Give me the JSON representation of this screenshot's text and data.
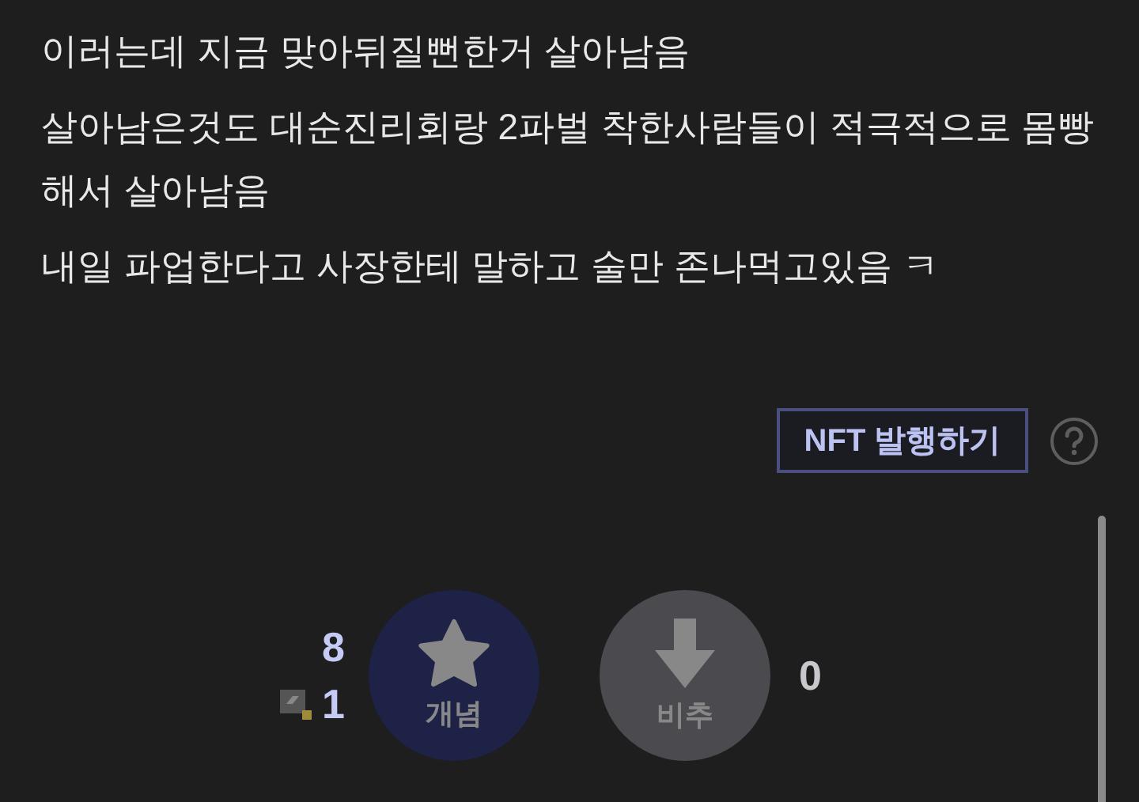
{
  "post": {
    "paragraphs": [
      "이러는데 지금 맞아뒤질뻔한거 살아남음",
      "살아남은것도 대순진리회랑 2파벌 착한사람들이 적극적으로 몸빵해서 살아남음",
      "내일 파업한다고 사장한테 말하고 술만 존나먹고있음 ㅋ"
    ]
  },
  "nft_button": {
    "label": "NFT 발행하기"
  },
  "votes": {
    "up_count": "8",
    "fixed_count": "1",
    "up_label": "개념",
    "down_label": "비추",
    "down_count": "0"
  }
}
